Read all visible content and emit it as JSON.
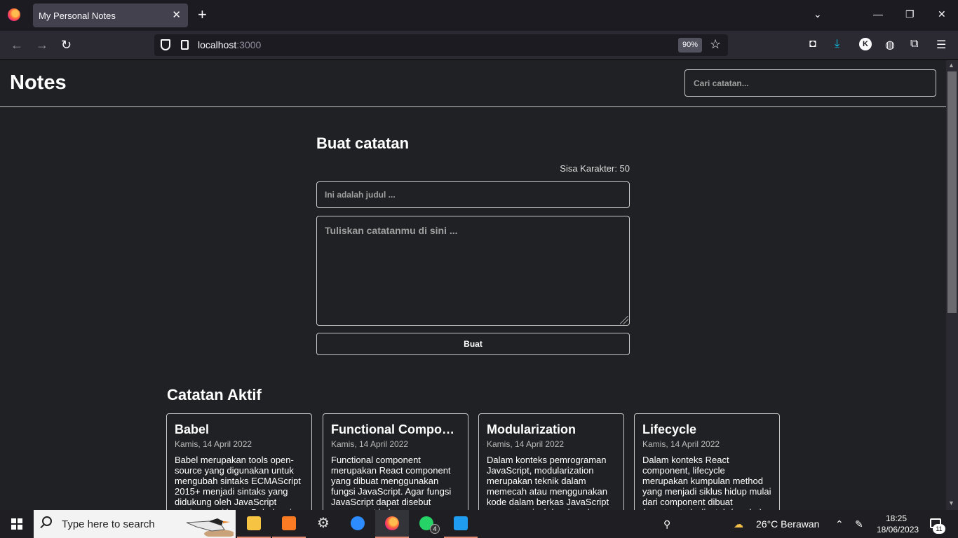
{
  "browser": {
    "tab_title": "My Personal Notes",
    "url_host": "localhost",
    "url_port": ":3000",
    "zoom": "90%",
    "avatar_letter": "K"
  },
  "app": {
    "logo": "Notes",
    "search_placeholder": "Cari catatan..."
  },
  "form": {
    "title": "Buat catatan",
    "char_remaining": "Sisa Karakter: 50",
    "title_placeholder": "Ini adalah judul ...",
    "body_placeholder": "Tuliskan catatanmu di sini ...",
    "submit_label": "Buat"
  },
  "active_notes": {
    "title": "Catatan Aktif",
    "notes": [
      {
        "title": "Babel",
        "date": "Kamis, 14 April 2022",
        "body": "Babel merupakan tools open-source yang digunakan untuk mengubah sintaks ECMAScript 2015+ menjadi sintaks yang didukung oleh JavaScript engine versi lama. Babel sering"
      },
      {
        "title": "Functional Component",
        "date": "Kamis, 14 April 2022",
        "body": "Functional component merupakan React component yang dibuat menggunakan fungsi JavaScript. Agar fungsi JavaScript dapat disebut component ia harus"
      },
      {
        "title": "Modularization",
        "date": "Kamis, 14 April 2022",
        "body": "Dalam konteks pemrograman JavaScript, modularization merupakan teknik dalam memecah atau menggunakan kode dalam berkas JavaScript secara terpisah berdasarkan"
      },
      {
        "title": "Lifecycle",
        "date": "Kamis, 14 April 2022",
        "body": "Dalam konteks React component, lifecycle merupakan kumpulan method yang menjadi siklus hidup mulai dari component dibuat (constructor), dicetak (render)"
      }
    ]
  },
  "taskbar": {
    "search_placeholder": "Type here to search",
    "whatsapp_badge": "4",
    "weather": "26°C  Berawan",
    "time": "18:25",
    "date": "18/06/2023",
    "notifications": "11"
  }
}
